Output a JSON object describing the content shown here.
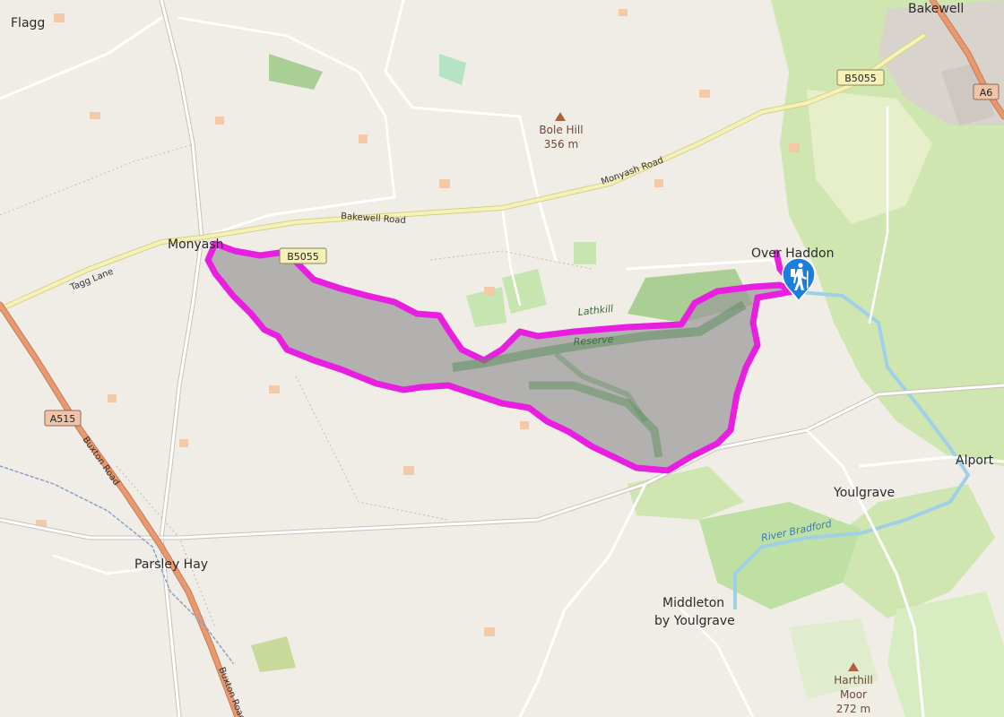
{
  "colors": {
    "background": "#f0ede6",
    "woodland": "#cfe6b0",
    "park": "#b9e0a8",
    "water": "#9fd0e8",
    "minor_road": "#ffffff",
    "secondary_road": "#f6f1b6",
    "primary_road": "#e8996f",
    "route": "#e81fe0",
    "route_fill": "#9a9a9a",
    "marker": "#1a7fdc"
  },
  "places": {
    "flagg": "Flagg",
    "bakewell": "Bakewell",
    "monyash": "Monyash",
    "over_haddon": "Over Haddon",
    "alport": "Alport",
    "youlgrave": "Youlgrave",
    "parsley_hay": "Parsley Hay",
    "middleton_1": "Middleton",
    "middleton_2": "by Youlgrave"
  },
  "peaks": {
    "bole_hill_name": "Bole Hill",
    "bole_hill_height": "356 m",
    "harthill_name_1": "Harthill",
    "harthill_name_2": "Moor",
    "harthill_height": "272 m"
  },
  "roads": {
    "b5055_shield_1": "B5055",
    "b5055_shield_2": "B5055",
    "a6_shield": "A6",
    "a515_shield": "A515",
    "bakewell_road": "Bakewell Road",
    "monyash_road": "Monyash Road",
    "taggs_lane": "Tagg Lane",
    "buxton_road_1": "Buxton Road",
    "buxton_road_2": "Buxton Road"
  },
  "water": {
    "river_bradford": "River Bradford"
  },
  "features": {
    "lathkill": "Lathkill",
    "reserve": "Reserve"
  },
  "marker": {
    "icon": "hiker-icon"
  }
}
